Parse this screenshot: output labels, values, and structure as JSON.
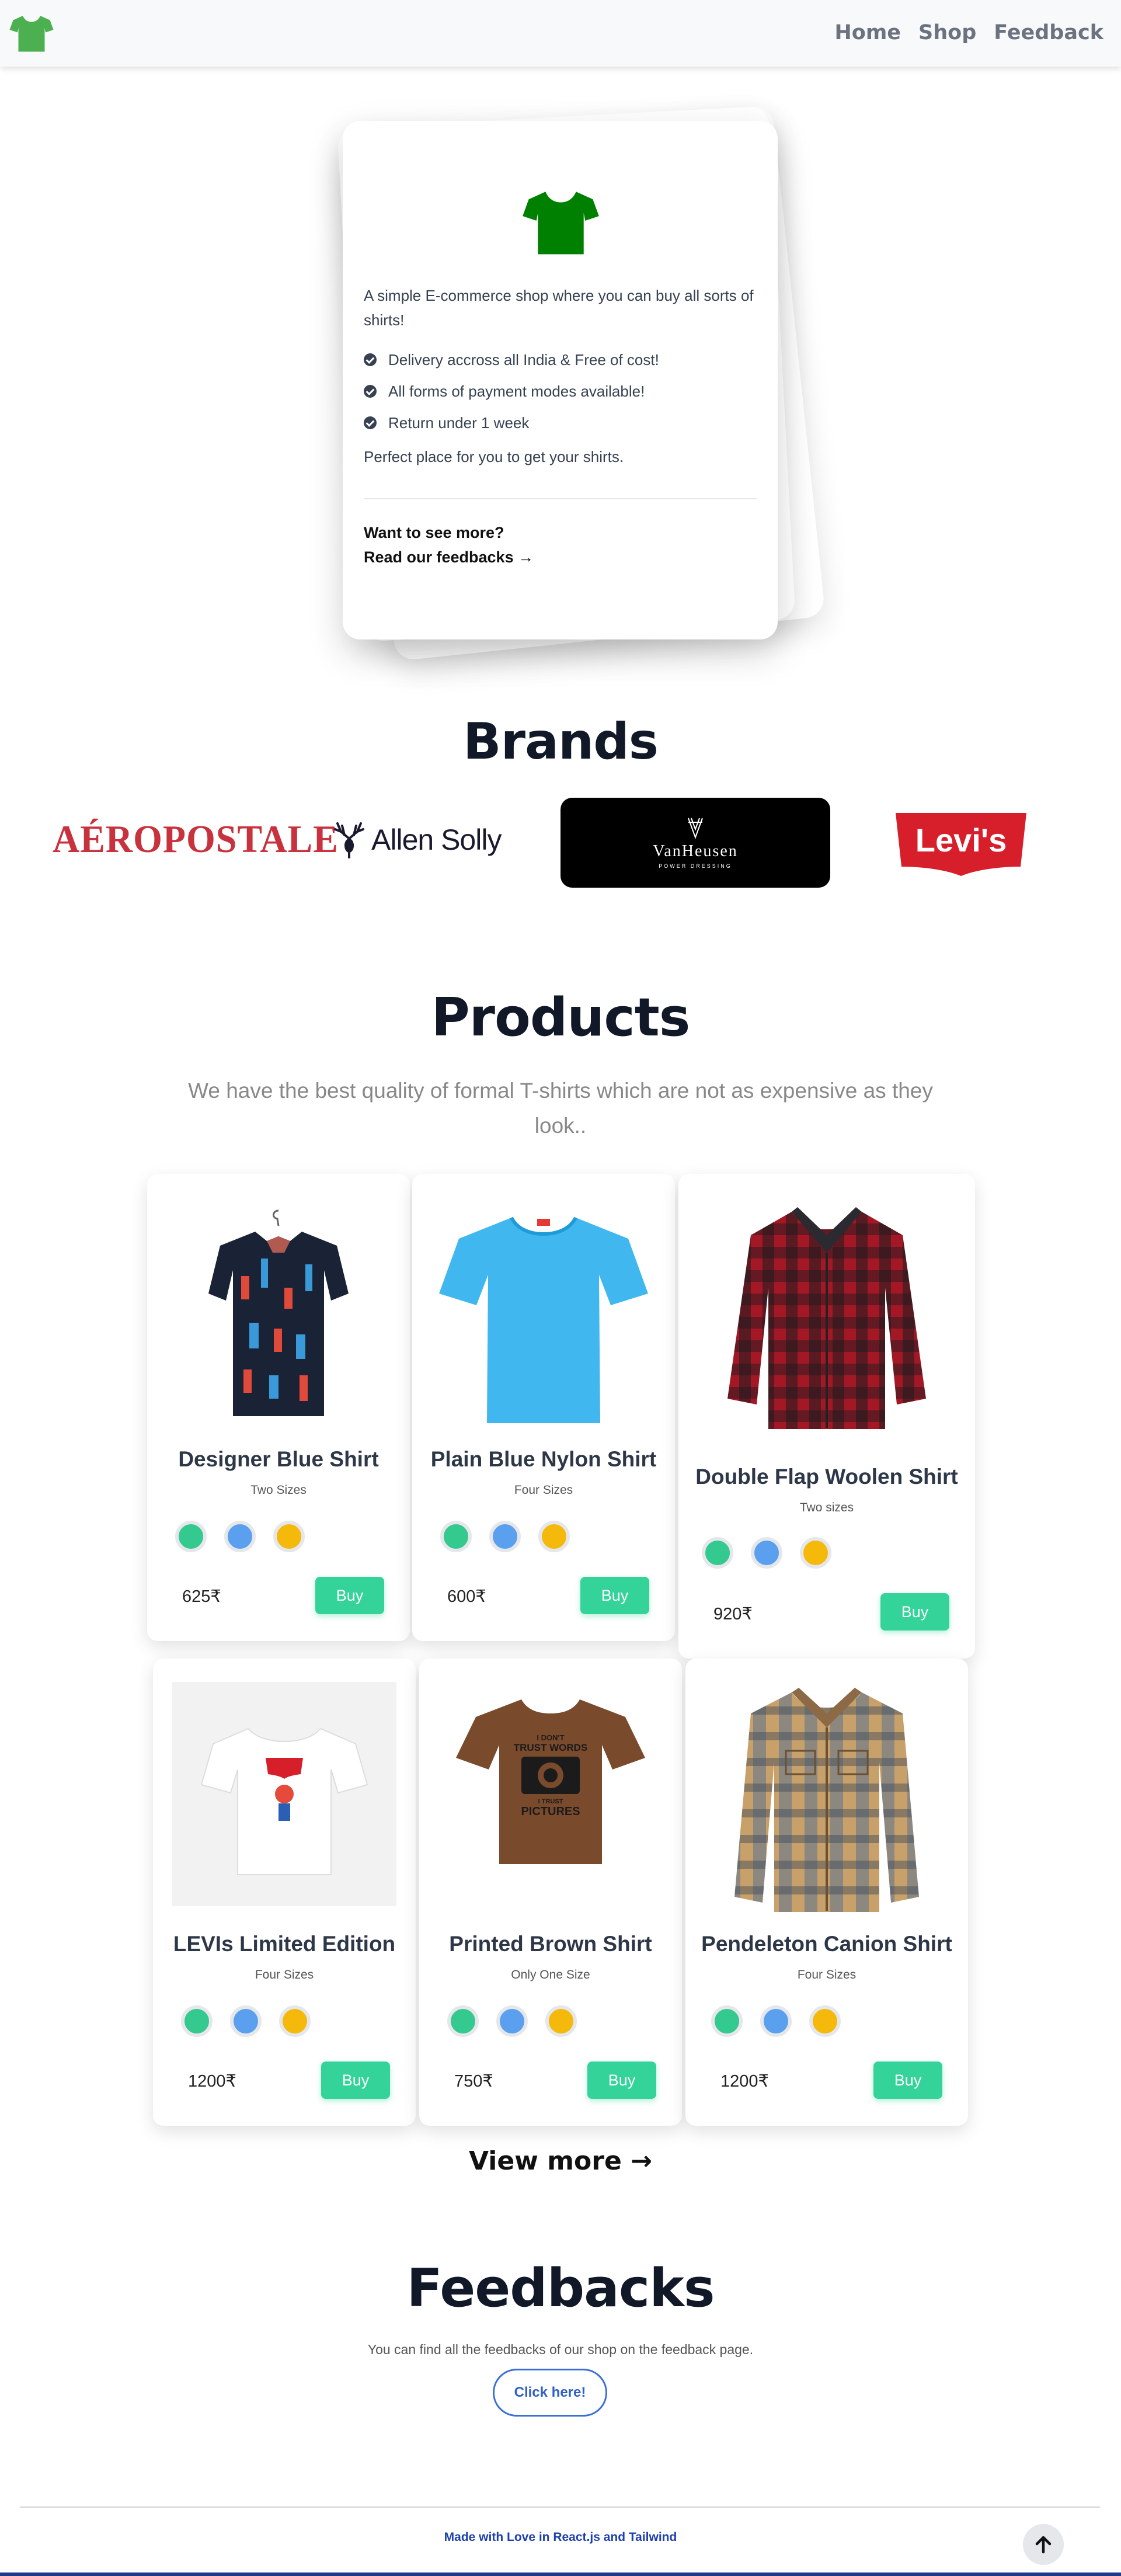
{
  "nav": {
    "logo_icon": "tshirt-icon",
    "links": [
      "Home",
      "Shop",
      "Feedback"
    ]
  },
  "hero": {
    "description": "A simple E-commerce shop where you can buy all sorts of shirts!",
    "features": [
      "Delivery accross all India & Free of cost!",
      "All forms of payment modes available!",
      "Return under 1 week"
    ],
    "perfect": "Perfect place for you to get your shirts.",
    "more_question": "Want to see more?",
    "more_link": "Read our feedbacks →"
  },
  "brands": {
    "title": "Brands",
    "items": [
      "AÉROPOSTALE",
      "Allen Solly",
      "VanHeusen",
      "Levi's"
    ],
    "vanheusen_sub": "POWER DRESSING"
  },
  "products": {
    "title": "Products",
    "subtitle": "We have the best quality of formal T-shirts which are not as expensive as they look..",
    "items": [
      {
        "name": "Designer Blue Shirt",
        "sizes": "Two Sizes",
        "price": "625₹",
        "buy": "Buy"
      },
      {
        "name": "Plain Blue Nylon Shirt",
        "sizes": "Four Sizes",
        "price": "600₹",
        "buy": "Buy"
      },
      {
        "name": "Double Flap Woolen Shirt",
        "sizes": "Two sizes",
        "price": "920₹",
        "buy": "Buy"
      },
      {
        "name": "LEVIs Limited Edition",
        "sizes": "Four Sizes",
        "price": "1200₹",
        "buy": "Buy"
      },
      {
        "name": "Printed Brown Shirt",
        "sizes": "Only One Size",
        "price": "750₹",
        "buy": "Buy"
      },
      {
        "name": "Pendeleton Canion Shirt",
        "sizes": "Four Sizes",
        "price": "1200₹",
        "buy": "Buy"
      }
    ],
    "colors": {
      "green": "#34c98e",
      "blue": "#5aa0ef",
      "yellow": "#f5b90b"
    },
    "view_more": "View more →"
  },
  "feedbacks": {
    "title": "Feedbacks",
    "text": "You can find all the feedbacks of our shop on the feedback page.",
    "button": "Click here!"
  },
  "footer": {
    "text": "Made with Love in React.js and Tailwind",
    "to_top_icon": "arrow-up-icon"
  }
}
